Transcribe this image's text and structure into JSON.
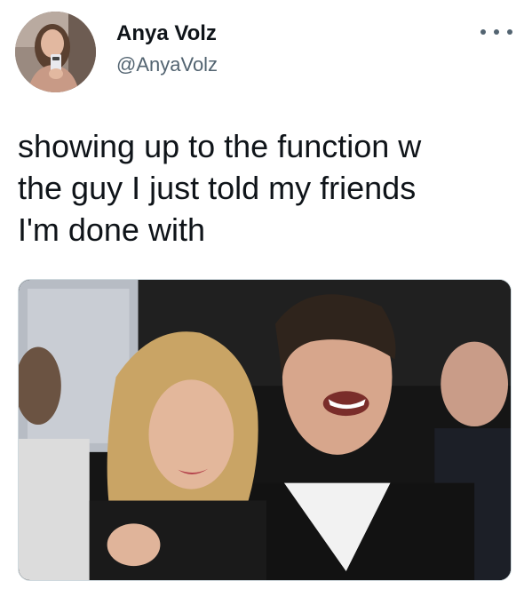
{
  "tweet": {
    "author": {
      "display_name": "Anya Volz",
      "handle": "@AnyaVolz",
      "avatar_icon": "profile-photo"
    },
    "more_icon": "more-options-icon",
    "text_lines": [
      "showing up to the function w",
      "the guy I just told my friends",
      "I'm done with"
    ],
    "media": {
      "type": "photo",
      "icon": "photo-attachment"
    }
  },
  "colors": {
    "name": "#0f1419",
    "handle": "#536471",
    "border": "#cfd9de",
    "background": "#ffffff"
  }
}
